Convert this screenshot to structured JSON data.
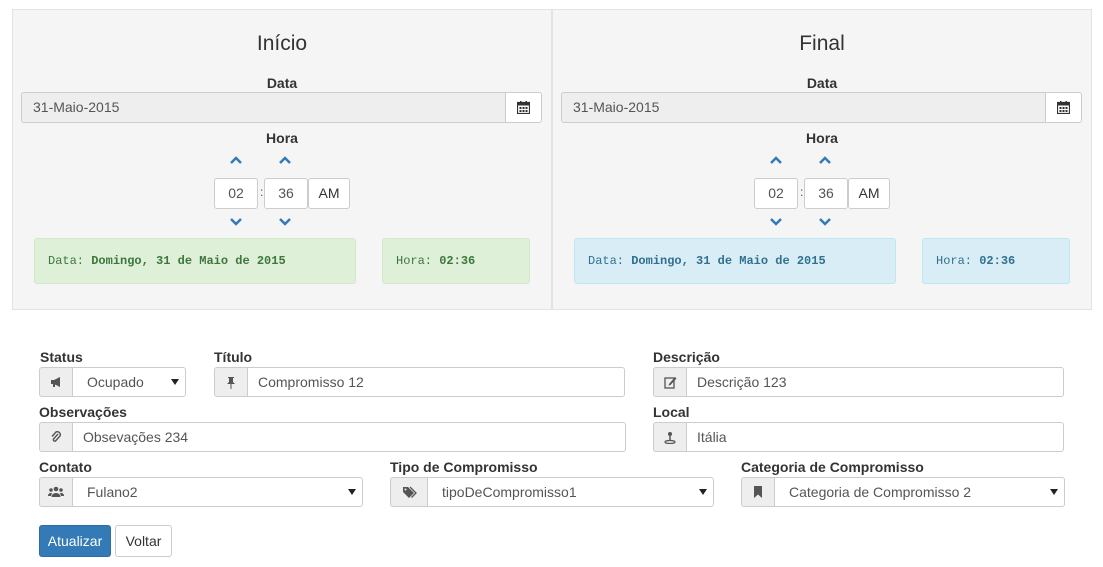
{
  "start": {
    "title": "Início",
    "date_label": "Data",
    "date_value": "31-Maio-2015",
    "time_label": "Hora",
    "hour": "02",
    "minute": "36",
    "ampm": "AM",
    "date_alert_prefix": "Data:",
    "date_alert_value": "Domingo, 31 de Maio de 2015",
    "time_alert_prefix": "Hora:",
    "time_alert_value": "02:36"
  },
  "end": {
    "title": "Final",
    "date_label": "Data",
    "date_value": "31-Maio-2015",
    "time_label": "Hora",
    "hour": "02",
    "minute": "36",
    "ampm": "AM",
    "date_alert_prefix": "Data:",
    "date_alert_value": "Domingo, 31 de Maio de 2015",
    "time_alert_prefix": "Hora:",
    "time_alert_value": "02:36"
  },
  "form": {
    "status": {
      "label": "Status",
      "value": "Ocupado",
      "icon": "bullhorn-icon"
    },
    "titulo": {
      "label": "Título",
      "value": "Compromisso 12",
      "icon": "pushpin-icon"
    },
    "descricao": {
      "label": "Descrição",
      "value": "Descrição 123",
      "icon": "edit-icon"
    },
    "observacoes": {
      "label": "Observações",
      "value": "Obsevações 234",
      "icon": "paperclip-icon"
    },
    "local": {
      "label": "Local",
      "value": "Itália",
      "icon": "map-marker-icon"
    },
    "contato": {
      "label": "Contato",
      "value": "Fulano2",
      "icon": "users-icon"
    },
    "tipo": {
      "label": "Tipo de Compromisso",
      "value": "tipoDeCompromisso1",
      "icon": "tags-icon"
    },
    "categoria": {
      "label": "Categoria de Compromisso",
      "value": "Categoria de Compromisso 2",
      "icon": "bookmark-icon"
    }
  },
  "buttons": {
    "update": "Atualizar",
    "back": "Voltar"
  },
  "colors": {
    "primary": "#337ab7",
    "chevron": "#337ab7",
    "success_bg": "#dff0d8",
    "success_text": "#3c763d",
    "info_bg": "#d9edf7",
    "info_text": "#31708f"
  }
}
